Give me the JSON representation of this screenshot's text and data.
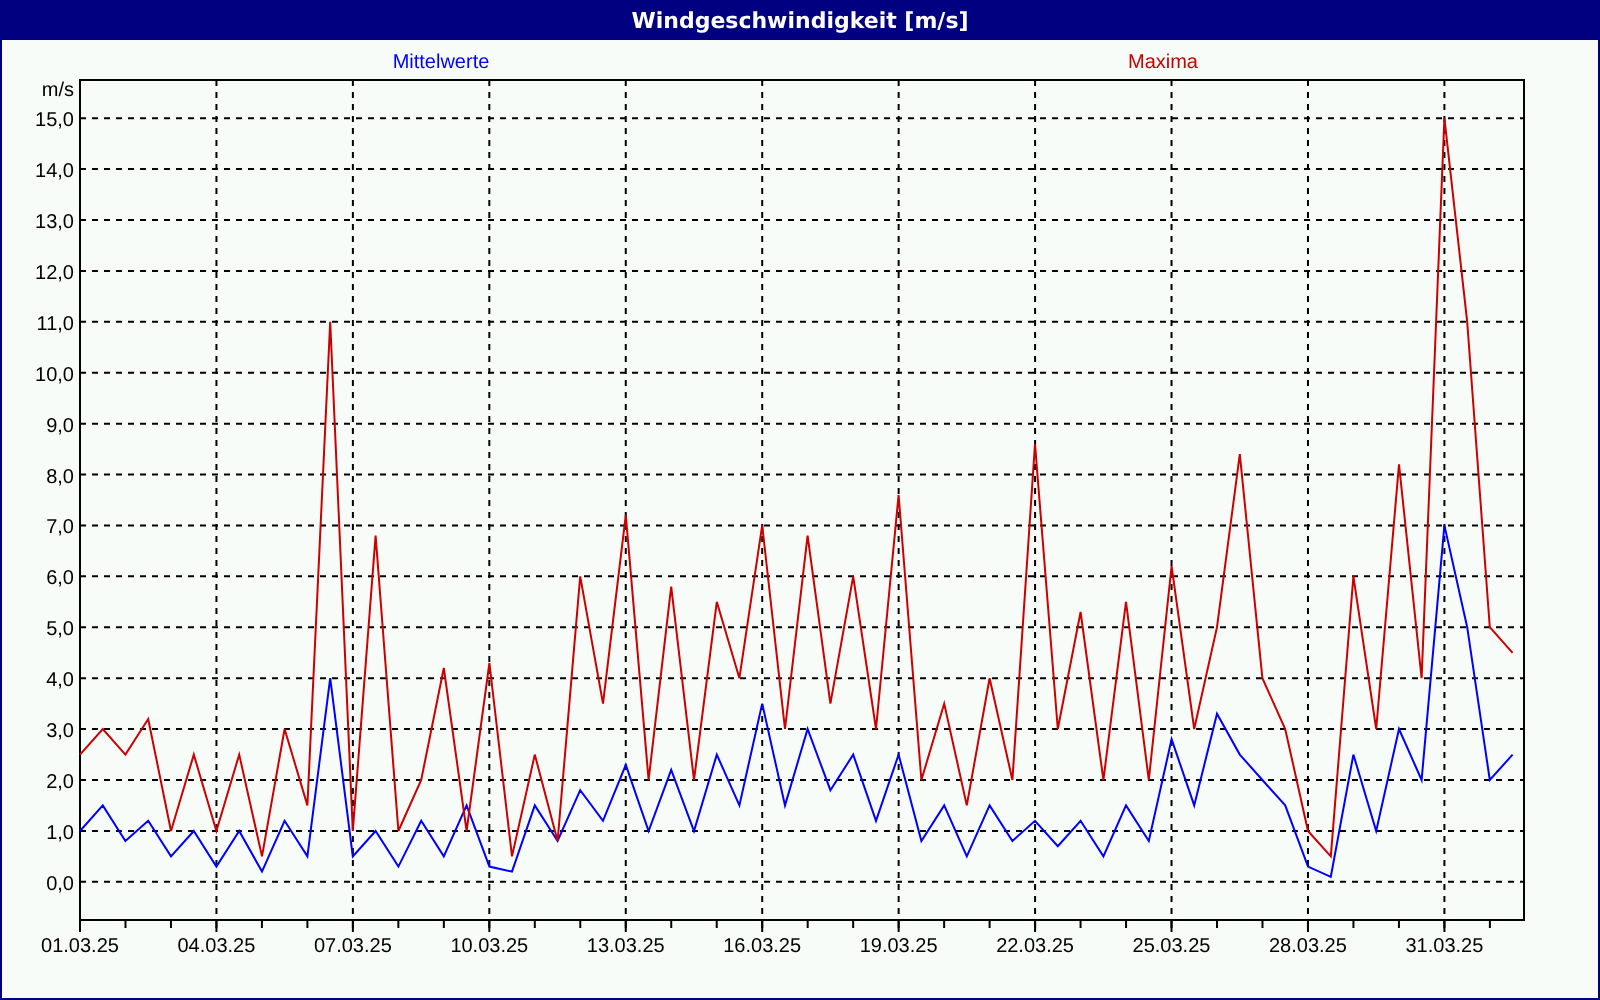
{
  "window": {
    "title": "Windgeschwindigkeit [m/s]"
  },
  "chart_data": {
    "type": "line",
    "ylabel": "m/s",
    "grid": true,
    "categories": [
      "01.03.25",
      null,
      null,
      null,
      null,
      null,
      "04.03.25",
      null,
      null,
      null,
      null,
      null,
      "07.03.25",
      null,
      null,
      null,
      null,
      null,
      "10.03.25",
      null,
      null,
      null,
      null,
      null,
      "13.03.25",
      null,
      null,
      null,
      null,
      null,
      "16.03.25",
      null,
      null,
      null,
      null,
      null,
      "19.03.25",
      null,
      null,
      null,
      null,
      null,
      "22.03.25",
      null,
      null,
      null,
      null,
      null,
      "25.03.25",
      null,
      null,
      null,
      null,
      null,
      "28.03.25",
      null,
      null,
      null,
      null,
      null,
      "31.03.25",
      null,
      null,
      null
    ],
    "ylim": [
      -0.75,
      15.75
    ],
    "yticks": [
      {
        "value": 0,
        "label": "0,0"
      },
      {
        "value": 1,
        "label": "1,0"
      },
      {
        "value": 2,
        "label": "2,0"
      },
      {
        "value": 3,
        "label": "3,0"
      },
      {
        "value": 4,
        "label": "4,0"
      },
      {
        "value": 5,
        "label": "5,0"
      },
      {
        "value": 6,
        "label": "6,0"
      },
      {
        "value": 7,
        "label": "7,0"
      },
      {
        "value": 8,
        "label": "8,0"
      },
      {
        "value": 9,
        "label": "9,0"
      },
      {
        "value": 10,
        "label": "10,0"
      },
      {
        "value": 11,
        "label": "11,0"
      },
      {
        "value": 12,
        "label": "12,0"
      },
      {
        "value": 13,
        "label": "13,0"
      },
      {
        "value": 14,
        "label": "14,0"
      },
      {
        "value": 15,
        "label": "15,0"
      }
    ],
    "series": [
      {
        "name": "Mittelwerte",
        "color": "#0000ff",
        "values": [
          1.0,
          1.5,
          0.8,
          1.2,
          0.5,
          1.0,
          0.3,
          1.0,
          0.2,
          1.2,
          0.5,
          4.0,
          0.5,
          1.0,
          0.3,
          1.2,
          0.5,
          1.5,
          0.3,
          0.2,
          1.5,
          0.8,
          1.8,
          1.2,
          2.3,
          1.0,
          2.2,
          1.0,
          2.5,
          1.5,
          3.5,
          1.5,
          3.0,
          1.8,
          2.5,
          1.2,
          2.5,
          0.8,
          1.5,
          0.5,
          1.5,
          0.8,
          1.2,
          0.7,
          1.2,
          0.5,
          1.5,
          0.8,
          2.8,
          1.5,
          3.3,
          2.5,
          2.0,
          1.5,
          0.3,
          0.1,
          2.5,
          1.0,
          3.0,
          2.0,
          7.0,
          5.0,
          2.0,
          2.5
        ]
      },
      {
        "name": "Maxima",
        "color": "#cc0000",
        "values": [
          2.5,
          3.0,
          2.5,
          3.2,
          1.0,
          2.5,
          1.0,
          2.5,
          0.5,
          3.0,
          1.5,
          11.0,
          1.0,
          6.8,
          1.0,
          2.0,
          4.2,
          1.0,
          4.3,
          0.5,
          2.5,
          0.8,
          6.0,
          3.5,
          7.2,
          2.0,
          5.8,
          2.0,
          5.5,
          4.0,
          7.0,
          3.0,
          6.8,
          3.5,
          6.0,
          3.0,
          7.6,
          2.0,
          3.5,
          1.5,
          4.0,
          2.0,
          8.6,
          3.0,
          5.3,
          2.0,
          5.5,
          2.0,
          6.2,
          3.0,
          5.0,
          8.4,
          4.0,
          3.0,
          1.0,
          0.5,
          6.0,
          3.0,
          8.2,
          4.0,
          15.0,
          11.0,
          5.0,
          4.5
        ]
      }
    ]
  }
}
